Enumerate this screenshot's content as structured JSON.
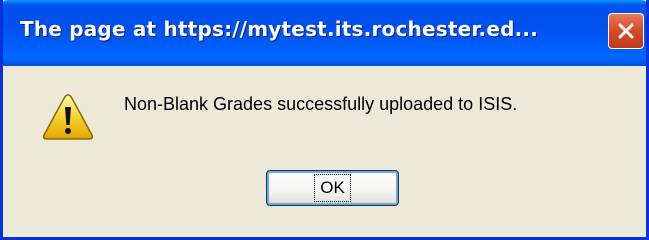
{
  "window": {
    "title": "The page at https://mytest.its.rochester.ed...",
    "close_icon": "close-icon"
  },
  "dialog": {
    "icon": "warning-icon",
    "message": "Non-Blank Grades successfully uploaded to ISIS.",
    "ok_label": "OK"
  },
  "colors": {
    "titlebar": "#0050ee",
    "frame": "#0831d9",
    "body": "#ece9d8",
    "close_button": "#d84e2c",
    "warning_yellow": "#f8d230"
  }
}
